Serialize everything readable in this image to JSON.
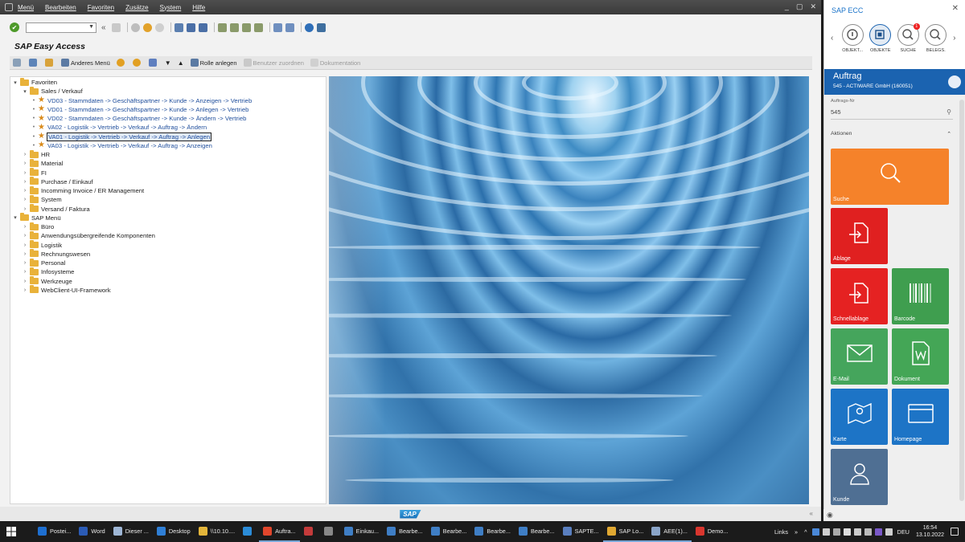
{
  "sap_window": {
    "menu": [
      "Menü",
      "Bearbeiten",
      "Favoriten",
      "Zusätze",
      "System",
      "Hilfe"
    ],
    "window_controls": [
      "_",
      "▢",
      "✕"
    ],
    "title": "SAP Easy Access",
    "app_toolbar": {
      "other_menu": "Anderes Menü",
      "create_role": "Rolle anlegen",
      "assign_users": "Benutzer zuordnen",
      "documentation": "Dokumentation"
    },
    "tree": [
      {
        "level": 0,
        "type": "folder",
        "toggle": "open",
        "label": "Favoriten"
      },
      {
        "level": 1,
        "type": "folder",
        "toggle": "open",
        "label": "Sales / Verkauf"
      },
      {
        "level": 2,
        "type": "fav",
        "label": "VD03 - Stammdaten -> Geschäftspartner -> Kunde -> Anzeigen -> Vertrieb"
      },
      {
        "level": 2,
        "type": "fav",
        "label": "VD01 - Stammdaten -> Geschäftspartner -> Kunde -> Anlegen -> Vertrieb"
      },
      {
        "level": 2,
        "type": "fav",
        "label": "VD02 - Stammdaten -> Geschäftspartner -> Kunde -> Ändern -> Vertrieb"
      },
      {
        "level": 2,
        "type": "fav",
        "label": "VA02 - Logistik -> Vertrieb -> Verkauf -> Auftrag -> Ändern"
      },
      {
        "level": 2,
        "type": "fav",
        "label": "VA01 - Logistik -> Vertrieb -> Verkauf -> Auftrag -> Anlegen",
        "selected": true
      },
      {
        "level": 2,
        "type": "fav",
        "label": "VA03 - Logistik -> Vertrieb -> Verkauf -> Auftrag -> Anzeigen"
      },
      {
        "level": 1,
        "type": "folder",
        "toggle": "closed",
        "label": "HR"
      },
      {
        "level": 1,
        "type": "folder",
        "toggle": "closed",
        "label": "Material"
      },
      {
        "level": 1,
        "type": "folder",
        "toggle": "closed",
        "label": "FI"
      },
      {
        "level": 1,
        "type": "folder",
        "toggle": "closed",
        "label": "Purchase / Einkauf"
      },
      {
        "level": 1,
        "type": "folder",
        "toggle": "closed",
        "label": "Incomming Invoice / ER Management"
      },
      {
        "level": 1,
        "type": "folder",
        "toggle": "closed",
        "label": "System"
      },
      {
        "level": 1,
        "type": "folder",
        "toggle": "closed",
        "label": "Versand / Faktura"
      },
      {
        "level": 0,
        "type": "folder",
        "toggle": "open",
        "label": "SAP Menü"
      },
      {
        "level": 1,
        "type": "folder",
        "toggle": "closed",
        "label": "Büro"
      },
      {
        "level": 1,
        "type": "folder",
        "toggle": "closed",
        "label": "Anwendungsübergreifende Komponenten"
      },
      {
        "level": 1,
        "type": "folder",
        "toggle": "closed",
        "label": "Logistik"
      },
      {
        "level": 1,
        "type": "folder",
        "toggle": "closed",
        "label": "Rechnungswesen"
      },
      {
        "level": 1,
        "type": "folder",
        "toggle": "closed",
        "label": "Personal"
      },
      {
        "level": 1,
        "type": "folder",
        "toggle": "closed",
        "label": "Infosysteme"
      },
      {
        "level": 1,
        "type": "folder",
        "toggle": "closed",
        "label": "Werkzeuge"
      },
      {
        "level": 1,
        "type": "folder",
        "toggle": "closed",
        "label": "WebClient-UI-Framework"
      }
    ],
    "status_logo": "SAP",
    "status_chevron": "«"
  },
  "side_panel": {
    "title": "SAP ECC",
    "close": "✕",
    "nav": [
      {
        "label": "OBJEKT...",
        "icon": "info-icon"
      },
      {
        "label": "OBJEKTE",
        "icon": "objects-icon",
        "active": true
      },
      {
        "label": "SUCHE",
        "icon": "search-icon",
        "badge": "1"
      },
      {
        "label": "BELEGS.",
        "icon": "document-search-icon"
      }
    ],
    "object_title": "Auftrag",
    "object_subtitle": "545 - ACTIWARE GmbH (160051)",
    "field_label": "Auftrags-Nr",
    "field_value": "545",
    "actions_label": "Aktionen",
    "tiles": [
      {
        "label": "Suche",
        "icon": "search-icon",
        "color": "#f5822a"
      },
      {
        "label": "Ablage",
        "icon": "file-import-icon",
        "color": "#e02020"
      },
      {
        "label": "Schnellablage",
        "icon": "file-import-icon",
        "color": "#e52222"
      },
      {
        "label": "Barcode",
        "icon": "barcode-icon",
        "color": "#3f9e4f"
      },
      {
        "label": "E-Mail",
        "icon": "mail-icon",
        "color": "#45a55c"
      },
      {
        "label": "Dokument",
        "icon": "word-document-icon",
        "color": "#44a656"
      },
      {
        "label": "Karte",
        "icon": "map-icon",
        "color": "#1d74c6"
      },
      {
        "label": "Homepage",
        "icon": "browser-window-icon",
        "color": "#1d74c6"
      },
      {
        "label": "Kunde",
        "icon": "person-icon",
        "color": "#4f6f93"
      }
    ]
  },
  "taskbar": {
    "items": [
      {
        "label": "Postei...",
        "color": "#1e6fd0"
      },
      {
        "label": "Word",
        "color": "#2b5bb5"
      },
      {
        "label": "Dieser ...",
        "color": "#9fb7d6"
      },
      {
        "label": "Desktop",
        "color": "#2f7fd6"
      },
      {
        "label": "\\\\10.10....",
        "color": "#e3b53a"
      },
      {
        "label": "",
        "color": "#2b8cd8"
      },
      {
        "label": "Auftra...",
        "color": "#e1462c",
        "open": true
      },
      {
        "label": "",
        "color": "#c43b3b"
      },
      {
        "label": "",
        "color": "#888888"
      },
      {
        "label": "Einkau...",
        "color": "#3f7ec5"
      },
      {
        "label": "Bearbe...",
        "color": "#3f7ec5"
      },
      {
        "label": "Bearbe...",
        "color": "#3f7ec5"
      },
      {
        "label": "Bearbe...",
        "color": "#3f7ec5"
      },
      {
        "label": "Bearbe...",
        "color": "#3f7ec5"
      },
      {
        "label": "SAPTE...",
        "color": "#5a7fbf"
      },
      {
        "label": "SAP Lo...",
        "color": "#e0a832",
        "open": true
      },
      {
        "label": "AEE(1)...",
        "color": "#8aa4c8",
        "open": true
      },
      {
        "label": "Demo...",
        "color": "#d9362e"
      }
    ],
    "links": "Links",
    "lang": "DEU",
    "time": "16:54",
    "date": "13.10.2022"
  }
}
